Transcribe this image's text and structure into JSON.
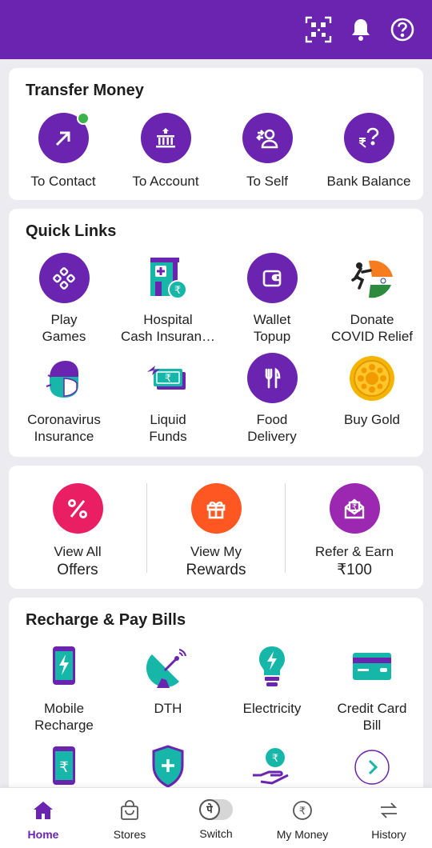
{
  "colors": {
    "brand": "#6a24b0",
    "offers": "#e91e63",
    "rewards": "#ff5722",
    "refer": "#9c27b0",
    "teal": "#16b6a9",
    "online": "#3ab34a"
  },
  "header": {
    "icons": [
      "qr-code-icon",
      "bell-icon",
      "help-icon"
    ]
  },
  "transfer": {
    "title": "Transfer Money",
    "items": [
      {
        "label": "To Contact",
        "icon": "arrow-up-right-icon"
      },
      {
        "label": "To Account",
        "icon": "bank-icon"
      },
      {
        "label": "To Self",
        "icon": "self-transfer-icon"
      },
      {
        "label": "Bank Balance",
        "icon": "rupee-question-icon"
      }
    ]
  },
  "quick_links": {
    "title": "Quick Links",
    "items": [
      {
        "label": "Play\nGames",
        "icon": "gamepad-icon"
      },
      {
        "label": "Hospital\nCash Insuran…",
        "icon": "hospital-icon"
      },
      {
        "label": "Wallet\nTopup",
        "icon": "wallet-icon"
      },
      {
        "label": "Donate\nCOVID Relief",
        "icon": "donate-flag-icon"
      },
      {
        "label": "Coronavirus\nInsurance",
        "icon": "mask-icon"
      },
      {
        "label": "Liquid\nFunds",
        "icon": "cash-icon"
      },
      {
        "label": "Food\nDelivery",
        "icon": "cutlery-icon"
      },
      {
        "label": "Buy Gold",
        "icon": "gold-coin-icon"
      }
    ]
  },
  "offers": {
    "items": [
      {
        "line1": "View All",
        "line2": "Offers",
        "icon": "percent-icon"
      },
      {
        "line1": "View My",
        "line2": "Rewards",
        "icon": "gift-icon"
      },
      {
        "line1": "Refer & Earn",
        "line2": "₹100",
        "icon": "refer-envelope-icon"
      }
    ]
  },
  "recharge": {
    "title": "Recharge & Pay Bills",
    "items": [
      {
        "label": "Mobile\nRecharge",
        "icon": "mobile-bolt-icon"
      },
      {
        "label": "DTH",
        "icon": "satellite-dish-icon"
      },
      {
        "label": "Electricity",
        "icon": "bulb-icon"
      },
      {
        "label": "Credit Card\nBill",
        "icon": "credit-card-icon"
      }
    ]
  },
  "nav": {
    "items": [
      {
        "label": "Home",
        "icon": "home-icon",
        "active": true
      },
      {
        "label": "Stores",
        "icon": "shopping-bag-icon"
      },
      {
        "label": "Switch",
        "icon": "switch-toggle-icon"
      },
      {
        "label": "My Money",
        "icon": "rupee-circle-icon"
      },
      {
        "label": "History",
        "icon": "history-arrows-icon"
      }
    ],
    "switch_glyph": "पे"
  }
}
